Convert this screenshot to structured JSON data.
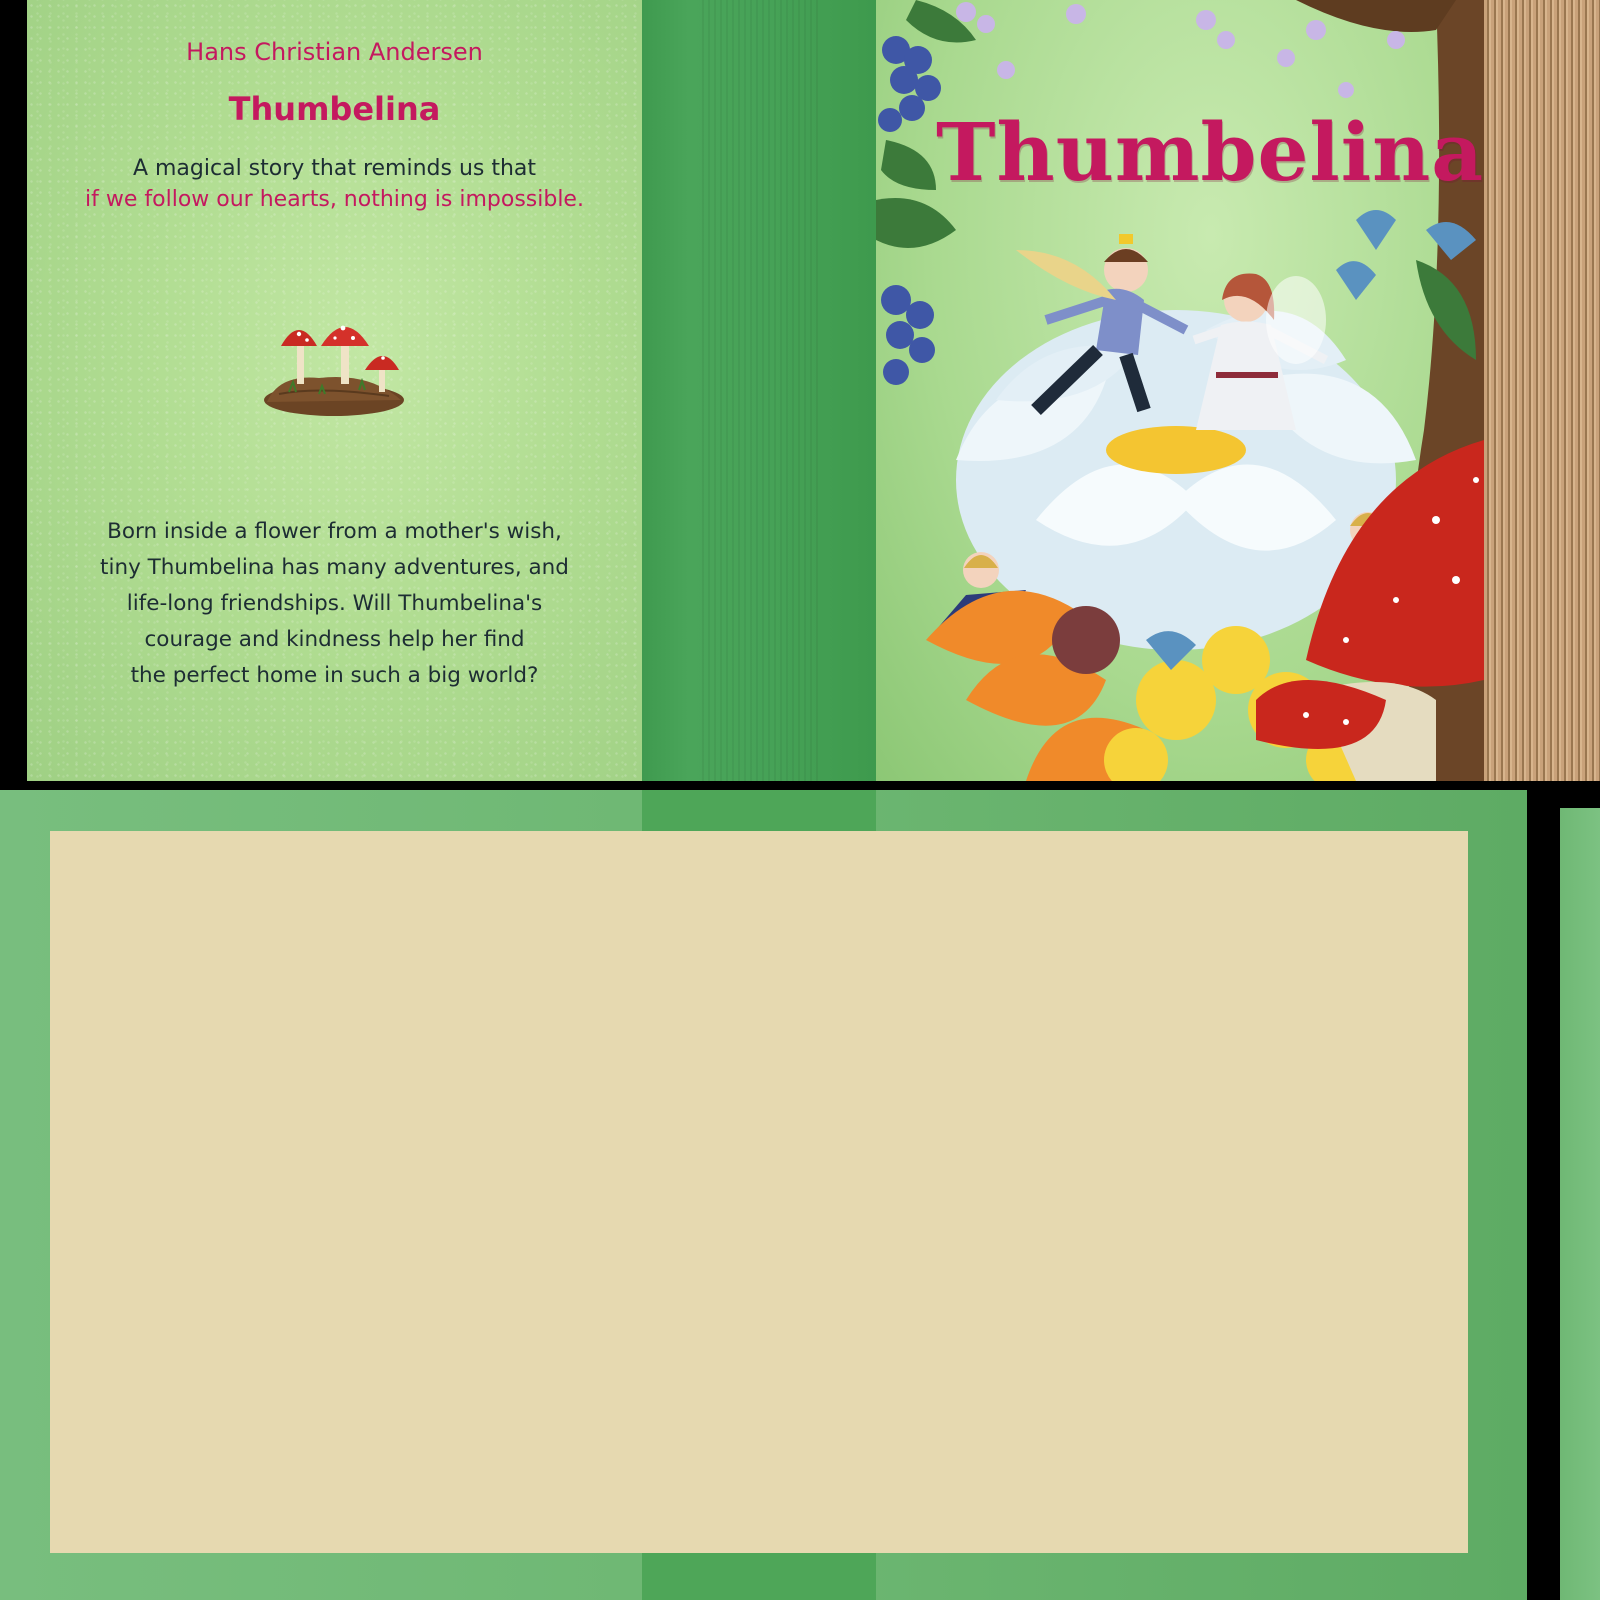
{
  "back_cover": {
    "author": "Hans Christian Andersen",
    "title": "Thumbelina",
    "tagline_line1": "A magical story that reminds us that",
    "tagline_line2": "if we follow our hearts, nothing is impossible.",
    "blurb_lines": [
      "Born inside a flower from a mother's wish,",
      "tiny Thumbelina has many adventures, and",
      "life-long friendships. Will Thumbelina's",
      "courage and kindness help her find",
      "the perfect home in such a big world?"
    ],
    "decoration_icon": "mushroom-cluster-icon"
  },
  "front_cover": {
    "title": "Thumbelina",
    "illustration": "thumbelina-and-prince-on-white-flower"
  },
  "colors": {
    "title_pink": "#c4195f",
    "body_text": "#1d2d33",
    "cover_green": "#b1dd92",
    "spine_green": "#46a257",
    "endpaper": "#e6d9b0"
  }
}
